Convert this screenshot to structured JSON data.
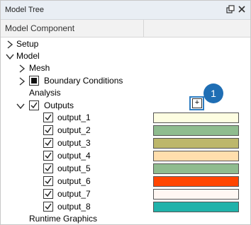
{
  "window": {
    "title": "Model Tree",
    "pin_icon": "pin-icon",
    "close_icon": "close-icon"
  },
  "columns": {
    "component": "Model Component"
  },
  "tree": {
    "setup": "Setup",
    "model": "Model",
    "mesh": "Mesh",
    "boundary_conditions": "Boundary Conditions",
    "analysis": "Analysis",
    "outputs": "Outputs",
    "runtime_graphics": "Runtime Graphics"
  },
  "outputs": [
    {
      "label": "output_1",
      "color": "#fdfde1"
    },
    {
      "label": "output_2",
      "color": "#8fbc8f"
    },
    {
      "label": "output_3",
      "color": "#bdb76b"
    },
    {
      "label": "output_4",
      "color": "#ffdead"
    },
    {
      "label": "output_5",
      "color": "#8fbc8f"
    },
    {
      "label": "output_6",
      "color": "#ff4500"
    },
    {
      "label": "output_7",
      "color": "#fff7f3"
    },
    {
      "label": "output_8",
      "color": "#20b2aa"
    }
  ],
  "add_button": {
    "label": "+"
  },
  "callout": {
    "number": "1"
  }
}
